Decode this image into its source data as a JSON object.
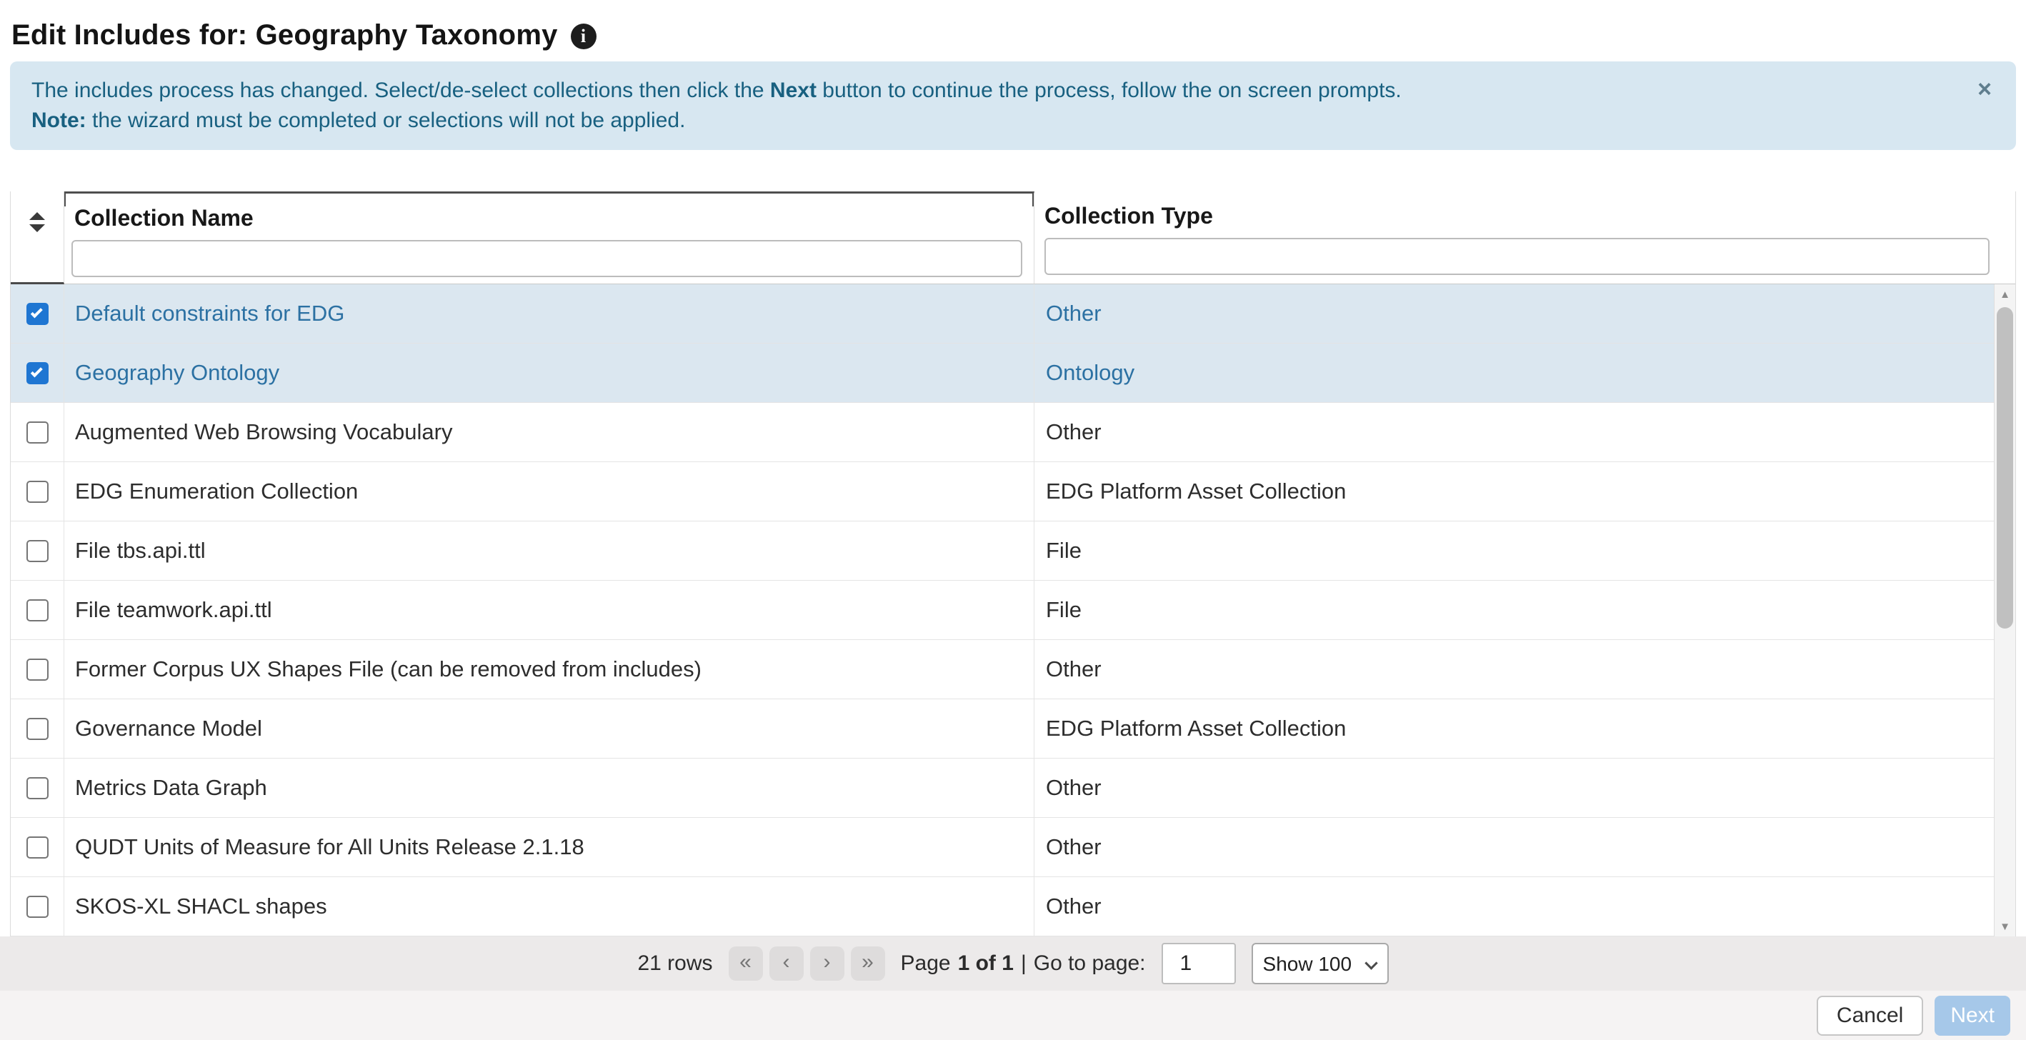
{
  "page": {
    "title": "Edit Includes for: Geography Taxonomy"
  },
  "icons": {
    "info": "i",
    "close": "×",
    "scroll_up": "▲",
    "scroll_down": "▼"
  },
  "banner": {
    "line1_part1": "The includes process has changed. Select/de-select collections then click the ",
    "line1_bold": "Next",
    "line1_part2": " button to continue the process, follow the on screen prompts.",
    "line2_bold": "Note:",
    "line2_text": " the wizard must be completed or selections will not be applied."
  },
  "table": {
    "columns": [
      {
        "label": "Collection Name",
        "filter_value": ""
      },
      {
        "label": "Collection Type",
        "filter_value": ""
      }
    ],
    "rows": [
      {
        "name": "Default constraints for EDG",
        "type": "Other",
        "checked": true
      },
      {
        "name": "Geography Ontology",
        "type": "Ontology",
        "checked": true
      },
      {
        "name": "Augmented Web Browsing Vocabulary",
        "type": "Other",
        "checked": false
      },
      {
        "name": "EDG Enumeration Collection",
        "type": "EDG Platform Asset Collection",
        "checked": false
      },
      {
        "name": "File tbs.api.ttl",
        "type": "File",
        "checked": false
      },
      {
        "name": "File teamwork.api.ttl",
        "type": "File",
        "checked": false
      },
      {
        "name": "Former Corpus UX Shapes File (can be removed from includes)",
        "type": "Other",
        "checked": false
      },
      {
        "name": "Governance Model",
        "type": "EDG Platform Asset Collection",
        "checked": false
      },
      {
        "name": "Metrics Data Graph",
        "type": "Other",
        "checked": false
      },
      {
        "name": "QUDT Units of Measure for All Units Release 2.1.18",
        "type": "Other",
        "checked": false
      },
      {
        "name": "SKOS-XL SHACL shapes",
        "type": "Other",
        "checked": false
      }
    ]
  },
  "pagination": {
    "rows_count": "21 rows",
    "first": "«",
    "prev": "‹",
    "next": "›",
    "last": "»",
    "page_label": "Page",
    "page_value": "1 of 1",
    "separator": "|",
    "goto_label": "Go to page:",
    "goto_value": "1",
    "page_size": "Show 100"
  },
  "actions": {
    "cancel": "Cancel",
    "next": "Next"
  },
  "colors": {
    "banner_bg": "#d7e7f1",
    "banner_text": "#186080",
    "selected_row_bg": "#dbe7f0",
    "selected_row_text": "#2c71a3",
    "checkbox_checked": "#1f76d2",
    "next_button_bg": "#a6c8e9"
  }
}
